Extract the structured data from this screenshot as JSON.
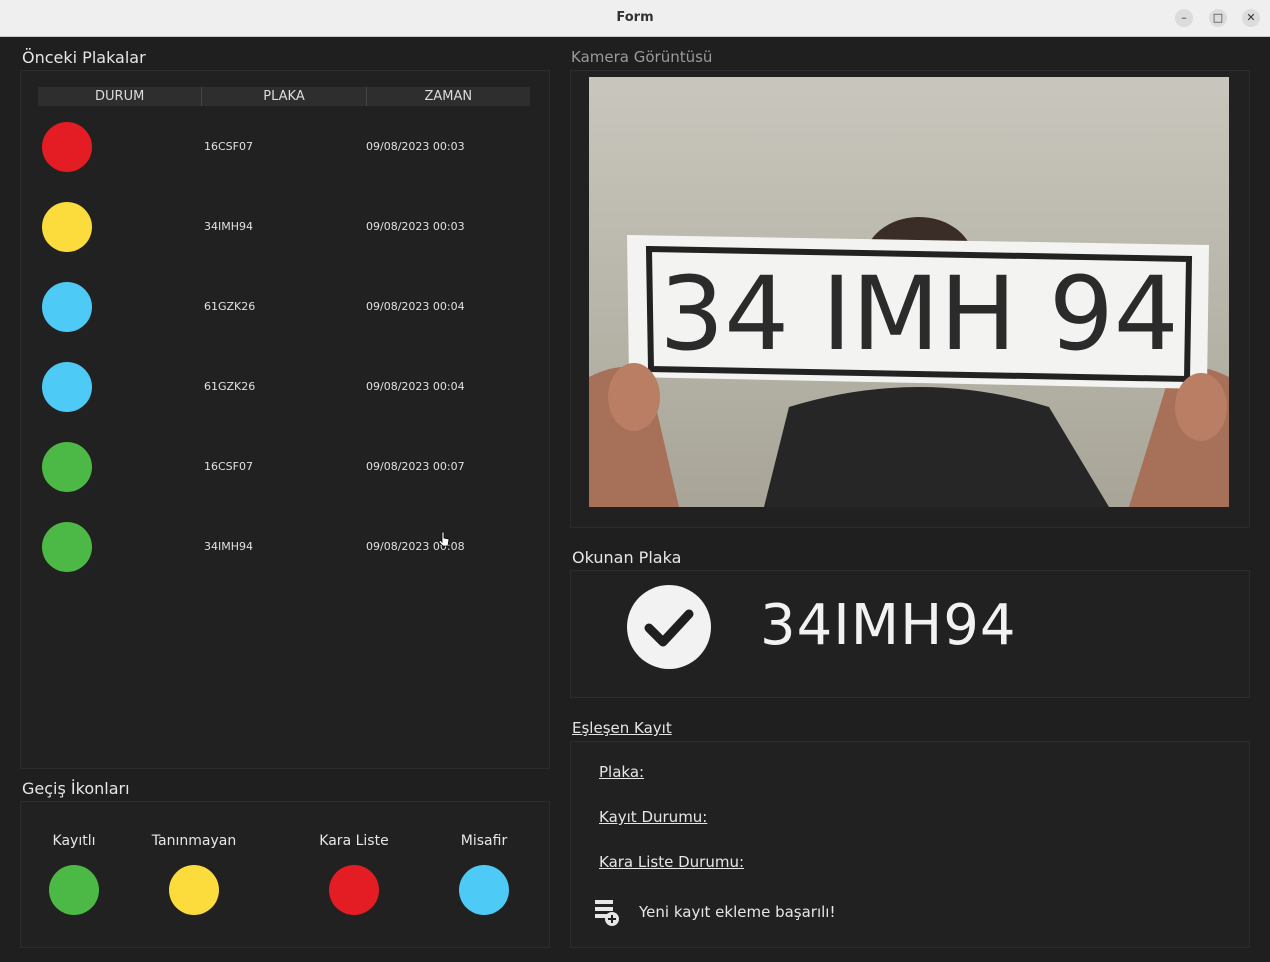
{
  "window": {
    "title": "Form"
  },
  "previous_plates": {
    "title": "Önceki Plakalar",
    "columns": [
      "DURUM",
      "PLAKA",
      "ZAMAN"
    ],
    "rows": [
      {
        "status": "Kara Liste",
        "color": "#e31d23",
        "plate": "16CSF07",
        "time": "09/08/2023 00:03"
      },
      {
        "status": "Tanınmayan",
        "color": "#fbdc3c",
        "plate": "34IMH94",
        "time": "09/08/2023 00:03"
      },
      {
        "status": "Misafir",
        "color": "#4ecaf6",
        "plate": "61GZK26",
        "time": "09/08/2023 00:04"
      },
      {
        "status": "Misafir",
        "color": "#4ecaf6",
        "plate": "61GZK26",
        "time": "09/08/2023 00:04"
      },
      {
        "status": "Kayıtlı",
        "color": "#4cb946",
        "plate": "16CSF07",
        "time": "09/08/2023 00:07"
      },
      {
        "status": "Kayıtlı",
        "color": "#4cb946",
        "plate": "34IMH94",
        "time": "09/08/2023 00:08"
      }
    ]
  },
  "legend": {
    "title": "Geçiş İkonları",
    "items": [
      {
        "label": "Kayıtlı",
        "color": "#4cb946"
      },
      {
        "label": "Tanınmayan",
        "color": "#fbdc3c"
      },
      {
        "label": "Kara Liste",
        "color": "#e31d23"
      },
      {
        "label": "Misafir",
        "color": "#4ecaf6"
      }
    ]
  },
  "camera": {
    "title": "Kamera Görüntüsü",
    "plate_text": "34 IMH 94"
  },
  "read_plate": {
    "title": "Okunan Plaka",
    "icon": "check-icon",
    "value": "34IMH94"
  },
  "matched_record": {
    "title": "Eşleşen Kayıt",
    "plate_label": "Plaka:",
    "status_label": "Kayıt Durumu:",
    "blacklist_label": "Kara Liste Durumu:",
    "message_icon": "add-record-icon",
    "message": "Yeni kayıt ekleme başarılı!"
  }
}
